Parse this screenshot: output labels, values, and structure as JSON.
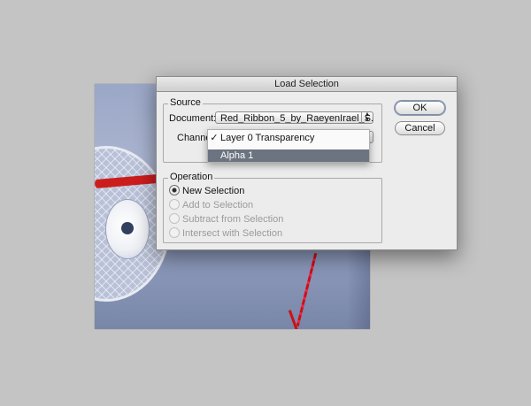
{
  "dialog": {
    "title": "Load Selection",
    "ok_label": "OK",
    "cancel_label": "Cancel"
  },
  "source": {
    "group_label": "Source",
    "document_label": "Document:",
    "document_value": "Red_Ribbon_5_by_RaeyenIrael_S...",
    "channel_label": "Channel:"
  },
  "channel_menu": {
    "items": [
      {
        "label": "Layer 0 Transparency",
        "checked": true
      },
      {
        "label": "Alpha 1",
        "highlighted": true
      }
    ]
  },
  "operation": {
    "group_label": "Operation",
    "options": [
      {
        "label": "New Selection",
        "selected": true,
        "enabled": true
      },
      {
        "label": "Add to Selection",
        "selected": false,
        "enabled": false
      },
      {
        "label": "Subtract from Selection",
        "selected": false,
        "enabled": false
      },
      {
        "label": "Intersect with Selection",
        "selected": false,
        "enabled": false
      }
    ]
  },
  "icons": {
    "check": "✓",
    "select_arrows": "updown-arrows-icon"
  }
}
